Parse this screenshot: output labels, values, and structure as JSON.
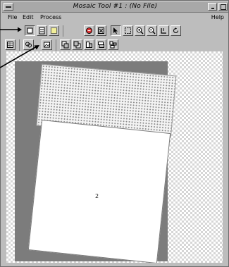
{
  "window": {
    "title": "Mosaic Tool #1 : (No File)"
  },
  "menubar": {
    "file": "File",
    "edit": "Edit",
    "process": "Process",
    "help": "Help"
  },
  "toolbar": {
    "row1": [
      {
        "name": "select-image-tool-icon",
        "pressed": true
      },
      {
        "name": "select-list-tool-icon",
        "pressed": false
      },
      {
        "name": "select-dotted-tool-icon",
        "pressed": false
      },
      {
        "name": "stop-tool-icon",
        "pressed": false
      },
      {
        "name": "fit-tool-icon",
        "pressed": false
      },
      {
        "name": "arrow-pointer-icon",
        "pressed": true
      },
      {
        "name": "rectangle-select-icon",
        "pressed": false
      },
      {
        "name": "zoom-in-icon",
        "pressed": false
      },
      {
        "name": "zoom-out-icon",
        "pressed": false
      },
      {
        "name": "pan-tool-icon",
        "pressed": false
      },
      {
        "name": "rotate-tool-icon",
        "pressed": false
      }
    ],
    "row2": [
      {
        "name": "grid-tool-icon",
        "pressed": false
      },
      {
        "name": "link-tool-icon",
        "pressed": false
      },
      {
        "name": "image-tool-icon",
        "pressed": false
      },
      {
        "name": "stack-front-icon",
        "pressed": false
      },
      {
        "name": "stack-back-icon",
        "pressed": false
      },
      {
        "name": "raise-icon",
        "pressed": false
      },
      {
        "name": "lower-icon",
        "pressed": false
      },
      {
        "name": "arrange-icon",
        "pressed": false
      }
    ]
  },
  "canvas": {
    "image_label": "2"
  }
}
